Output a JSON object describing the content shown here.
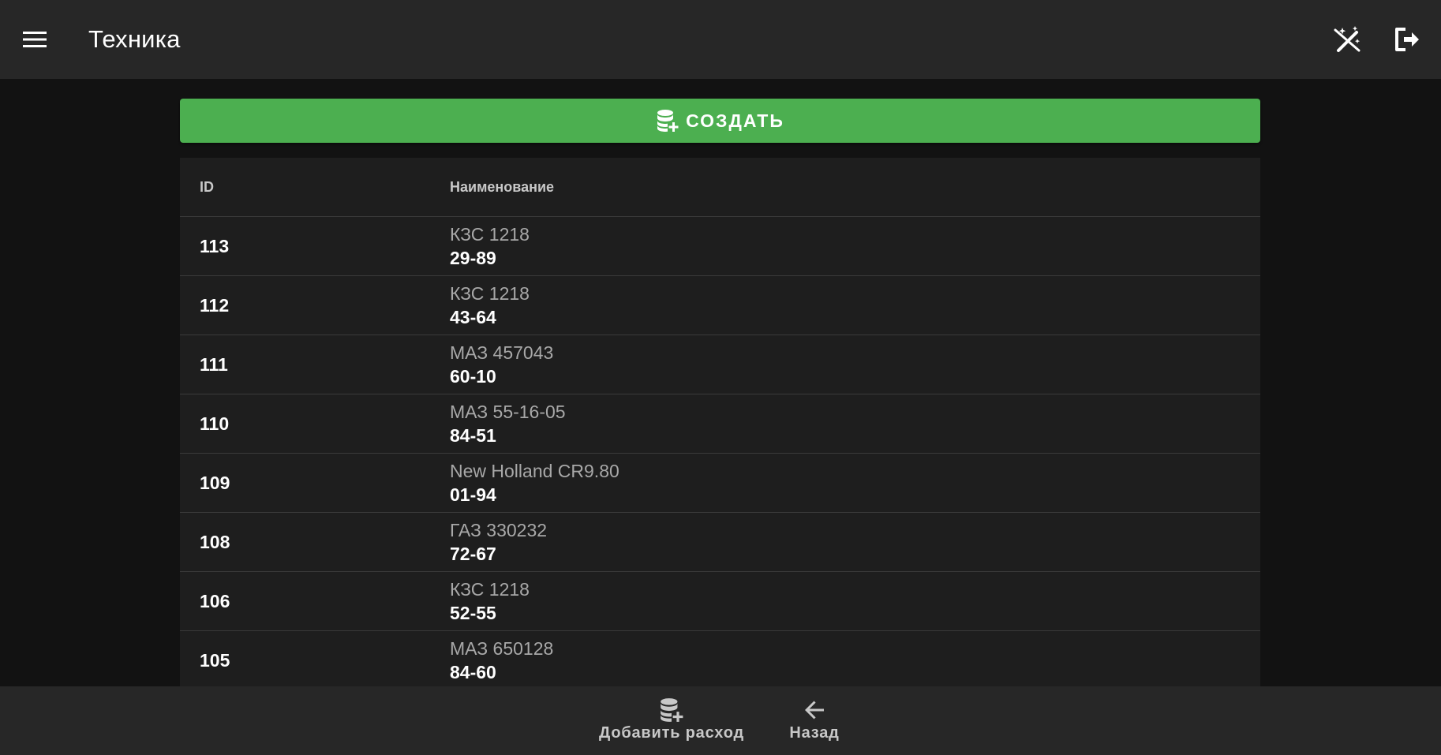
{
  "app_bar": {
    "title": "Техника",
    "menu_icon": "menu-icon",
    "theme_icon": "auto-fix-icon",
    "logout_icon": "logout-icon"
  },
  "create_button": {
    "label": "СОЗДАТЬ",
    "icon": "database-plus-icon",
    "color": "#4caf50"
  },
  "table": {
    "headers": [
      "ID",
      "Наименование"
    ],
    "rows": [
      {
        "id": "113",
        "model": "КЗС 1218",
        "number": "29-89"
      },
      {
        "id": "112",
        "model": "КЗС 1218",
        "number": "43-64"
      },
      {
        "id": "111",
        "model": "МАЗ 457043",
        "number": "60-10"
      },
      {
        "id": "110",
        "model": "МАЗ 55-16-05",
        "number": "84-51"
      },
      {
        "id": "109",
        "model": "New Holland CR9.80",
        "number": "01-94"
      },
      {
        "id": "108",
        "model": "ГАЗ 330232",
        "number": "72-67"
      },
      {
        "id": "106",
        "model": "КЗС 1218",
        "number": "52-55"
      },
      {
        "id": "105",
        "model": "МАЗ 650128",
        "number": "84-60"
      }
    ]
  },
  "bottom_nav": {
    "items": [
      {
        "label": "Добавить расход",
        "icon": "database-plus-icon"
      },
      {
        "label": "Назад",
        "icon": "arrow-left-icon"
      }
    ]
  },
  "colors": {
    "background": "#121212",
    "surface": "#1e1e1e",
    "app_bar": "#272727",
    "accent": "#4caf50"
  }
}
